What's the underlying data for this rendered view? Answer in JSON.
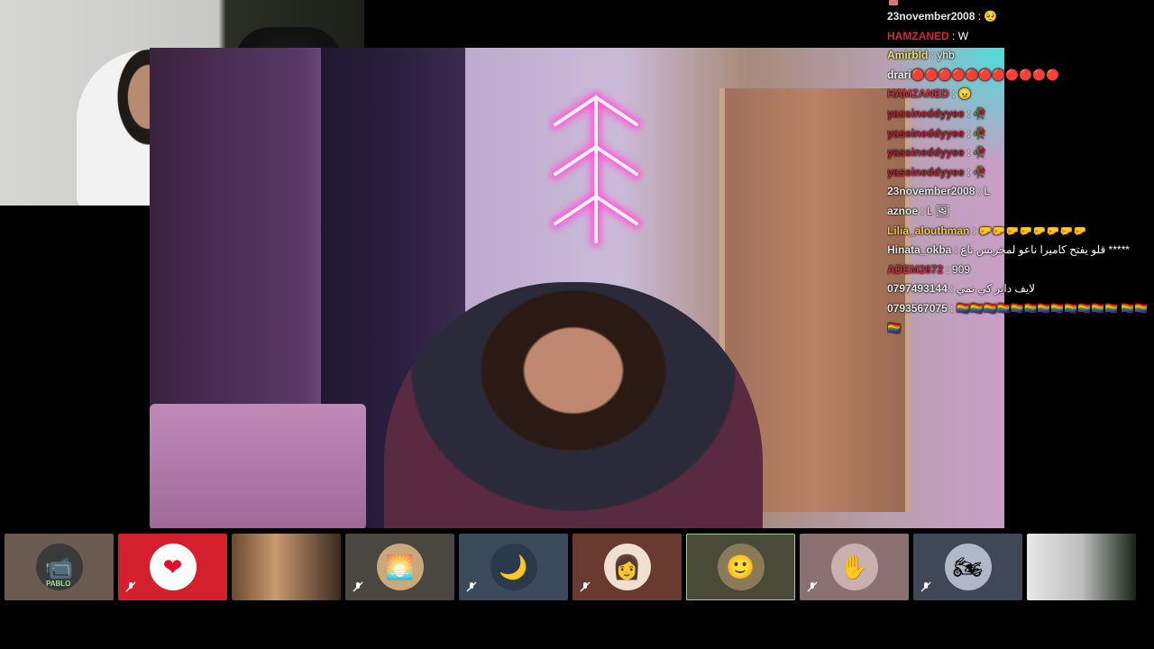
{
  "chat": {
    "messages": [
      {
        "user": "23november2008",
        "color": "#e8e8e8",
        "text": "🥺"
      },
      {
        "user": "HAMZANED",
        "color": "#d4283c",
        "text": "W"
      },
      {
        "user": "Amirbld",
        "color": "#f0e36a",
        "text": "yhb"
      },
      {
        "user": "drari",
        "color": "#ffffff",
        "text": "🔴🔴🔴🔴🔴🔴🔴🔴🔴🔴🔴",
        "nosep": true
      },
      {
        "user": "HAMZANED",
        "color": "#d4283c",
        "text": "😠"
      },
      {
        "user": "yassineddyyee",
        "color": "#b3202f",
        "text": "🥀"
      },
      {
        "user": "yassineddyyee",
        "color": "#b3202f",
        "text": "🥀"
      },
      {
        "user": "yassineddyyee",
        "color": "#b3202f",
        "text": "🥀"
      },
      {
        "user": "yassineddyyee",
        "color": "#b3202f",
        "text": "🥀"
      },
      {
        "user": "23november2008",
        "color": "#e8e8e8",
        "text": "L"
      },
      {
        "user": "aznoe",
        "color": "#e8e8e8",
        "text": "L 🖼"
      },
      {
        "user": "Lilia_alouthman",
        "color": "#f0c64a",
        "text": "🤛🤛🤛🤛🤛🤛🤛🤛"
      },
      {
        "user": "Hinata_okba",
        "color": "#e8e8e8",
        "text": "قلو يفتح كاميرا ناعو لمخربس ناع *****"
      },
      {
        "user": "ADEM2672",
        "color": "#c72c3a",
        "text": "909"
      },
      {
        "user": "0797493144",
        "color": "#e8e8e8",
        "text": "لايف داير كي نمي"
      },
      {
        "user": "0793567075",
        "color": "#e8e8e8",
        "text": "🏳️‍🌈🏳️‍🌈🏳️‍🌈🏳️‍🌈🏳️‍🌈🏳️‍🌈🏳️‍🌈🏳️‍🌈🏳️‍🌈🏳️‍🌈🏳️‍🌈🏳️‍🌈 🏳️‍🌈🏳️‍🌈🏳️‍🌈",
        "wrap": true
      }
    ]
  },
  "participants": [
    {
      "name": "PABLO",
      "bg": "#6a5a50",
      "avatar_bg": "#3a3a3a",
      "icon": "camera-off",
      "glyph": "📹"
    },
    {
      "name": "",
      "bg": "#d4202c",
      "avatar_bg": "#ffffff",
      "icon": "heart",
      "glyph": "❤",
      "muted": true
    },
    {
      "name": "",
      "bg": "#3a2a20",
      "avatar_bg": "transparent",
      "icon": "video-feed",
      "glyph": ""
    },
    {
      "name": "",
      "bg": "#4a4640",
      "avatar_bg": "#c9a87a",
      "icon": "sunset",
      "glyph": "🌅",
      "muted": true
    },
    {
      "name": "",
      "bg": "#3a4a5a",
      "avatar_bg": "#2a3a4a",
      "icon": "moon",
      "glyph": "🌙",
      "muted": true
    },
    {
      "name": "",
      "bg": "#6a3a30",
      "avatar_bg": "#f0e0d0",
      "icon": "girl-avatar",
      "glyph": "👩",
      "muted": true
    },
    {
      "name": "",
      "bg": "#4a4a38",
      "avatar_bg": "#8a7a5a",
      "icon": "person-photo",
      "glyph": "🙂",
      "active": true
    },
    {
      "name": "",
      "bg": "#8a7070",
      "avatar_bg": "#c8b0b0",
      "icon": "hand-photo",
      "glyph": "✋",
      "muted": true
    },
    {
      "name": "",
      "bg": "#404858",
      "avatar_bg": "#b0b8c8",
      "icon": "motorbike-photo",
      "glyph": "🏍",
      "muted": true
    },
    {
      "name": "",
      "bg": "#202820",
      "avatar_bg": "transparent",
      "icon": "video-feed",
      "glyph": ""
    }
  ]
}
